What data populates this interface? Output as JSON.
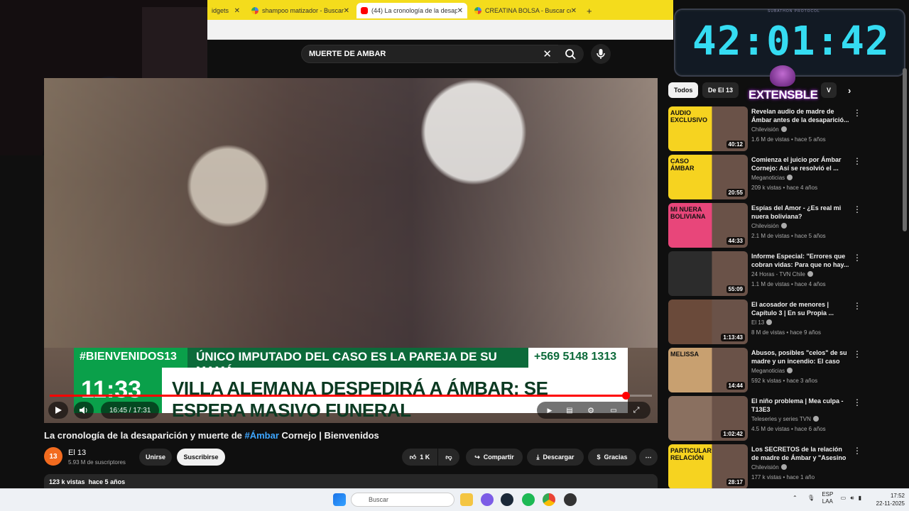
{
  "browser": {
    "tabs": [
      {
        "label": "idgets",
        "partial": true
      },
      {
        "label": "shampoo matizador - Buscar co"
      },
      {
        "label": "(44) La cronología de la desapa",
        "active": true
      },
      {
        "label": "CREATINA BOLSA - Buscar con"
      }
    ],
    "new_tab": "+"
  },
  "youtube": {
    "search_query": "MUERTE DE AMBAR",
    "video": {
      "banner_hashtag": "#BIENVENIDOS13",
      "banner_top": "ÚNICO IMPUTADO DEL CASO ES LA PAREJA DE SU MAMÁ",
      "banner_phone": "+569 5148 1313",
      "clock": "11:33",
      "headline": "VILLA ALEMANA DESPEDIRÁ A ÁMBAR: SE ESPERA MASIVO FUNERAL",
      "time": "16:45 / 17:31",
      "progress": 0.956
    },
    "title_pre": "La cronología de la desaparición y muerte de ",
    "title_hash": "#Ámbar",
    "title_post": " Cornejo | Bienvenidos",
    "channel": {
      "logo": "13",
      "name": "El 13",
      "subs": "5.93 M de suscriptores"
    },
    "buttons": {
      "join": "Unirse",
      "subscribe": "Suscribirse",
      "likes": "1 K",
      "share": "Compartir",
      "download": "Descargar",
      "thanks": "Gracias"
    },
    "description_meta": "123 k vistas  hace 5 años",
    "chips": [
      "Todos",
      "De El 13",
      "V"
    ],
    "recommendations": [
      {
        "title": "Revelan audio de madre de Ámbar antes de la desaparició...",
        "channel": "Chilevisión",
        "meta": "1.6 M de vistas • hace 5 años",
        "duration": "40:12",
        "thumb_text": "AUDIO EXCLUSIVO",
        "thumb_color": "#f6d320"
      },
      {
        "title": "Comienza el juicio por Ámbar Cornejo: Así se resolvió el ...",
        "channel": "Meganoticias",
        "meta": "209 k vistas • hace 4 años",
        "duration": "20:55",
        "thumb_text": "CASO ÁMBAR",
        "thumb_color": "#f6d320"
      },
      {
        "title": "Espías del Amor - ¿Es real mi nuera boliviana?",
        "channel": "Chilevisión",
        "meta": "2.1 M de vistas • hace 5 años",
        "duration": "44:33",
        "thumb_text": "MI NUERA BOLIVIANA",
        "thumb_color": "#e8467a"
      },
      {
        "title": "Informe Especial: \"Errores que cobran vidas: Para que no hay...",
        "channel": "24 Horas - TVN Chile",
        "meta": "1.1 M de vistas • hace 4 años",
        "duration": "55:09",
        "thumb_text": "",
        "thumb_color": "#2c2c2c"
      },
      {
        "title": "El acosador de menores | Capítulo 3 | En su Propia ...",
        "channel": "El 13",
        "meta": "8 M de vistas • hace 9 años",
        "duration": "1:13:43",
        "thumb_text": "",
        "thumb_color": "#6a4a3a"
      },
      {
        "title": "Abusos, posibles \"celos\" de su madre y un incendio: El caso d...",
        "channel": "Meganoticias",
        "meta": "592 k vistas • hace 3 años",
        "duration": "14:44",
        "thumb_text": "MELISSA",
        "thumb_color": "#c8a070"
      },
      {
        "title": "El niño problema | Mea culpa - T13E3",
        "channel": "Teleseries y series TVN",
        "meta": "4.5 M de vistas • hace 6 años",
        "duration": "1:02:42",
        "thumb_text": "",
        "thumb_color": "#8a7060"
      },
      {
        "title": "Los SECRETOS de la relación de madre de Ámbar y \"Asesino de...",
        "channel": "Chilevisión",
        "meta": "177 k vistas • hace 1 año",
        "duration": "28:17",
        "thumb_text": "PARTICULAR RELACIÓN",
        "thumb_color": "#f6d320"
      }
    ]
  },
  "overlay": {
    "timer": "42:01:42",
    "timer_label": "SUBATHON PROTOCOL",
    "badge": "EXTENSBLE"
  },
  "taskbar": {
    "search_placeholder": "Buscar",
    "lang": "ESP",
    "lang2": "LAA",
    "time": "17:52",
    "date": "22-11-2025"
  },
  "colors": {
    "accent_red": "#ff0000",
    "timer_cyan": "#35dcf2",
    "banner_green": "#0aa04a",
    "tab_yellow": "#f4dc1c",
    "link_blue": "#3ea6ff"
  }
}
